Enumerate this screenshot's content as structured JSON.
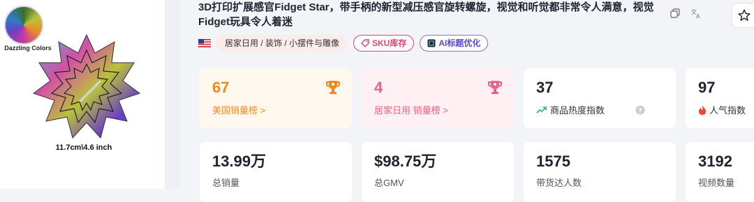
{
  "product_image": {
    "swatch_caption": "Dazzling Colors",
    "size_caption": "11.7cm\\4.6 inch"
  },
  "title": "3D打印扩展感官Fidget Star，带手柄的新型减压感官旋转螺旋，视觉和听觉都非常令人满意，视觉Fidget玩具令人着迷",
  "tags": {
    "category": "居家日用 / 装饰 / 小摆件与雕像",
    "sku": "SKU库存",
    "ai_title": "AI标题优化"
  },
  "rank_cards": [
    {
      "value": "67",
      "label": "美国销量榜 >"
    },
    {
      "value": "4",
      "label": "居家日用 销量榜 >"
    },
    {
      "value": "37",
      "label": "商品热度指数"
    },
    {
      "value": "97",
      "label": "人气指数"
    }
  ],
  "stat_cards": [
    {
      "value": "13.99万",
      "label": "总销量"
    },
    {
      "value": "$98.75万",
      "label": "总GMV"
    },
    {
      "value": "1575",
      "label": "带货达人数"
    },
    {
      "value": "3192",
      "label": "视频数量"
    }
  ],
  "colors": {
    "orange": "#f08a1f",
    "pink": "#ec5f86",
    "sku_red": "#e3426c",
    "ai_purple": "#7f6ee8",
    "heat_teal": "#2bb5a6",
    "fire_red": "#f0443a"
  }
}
